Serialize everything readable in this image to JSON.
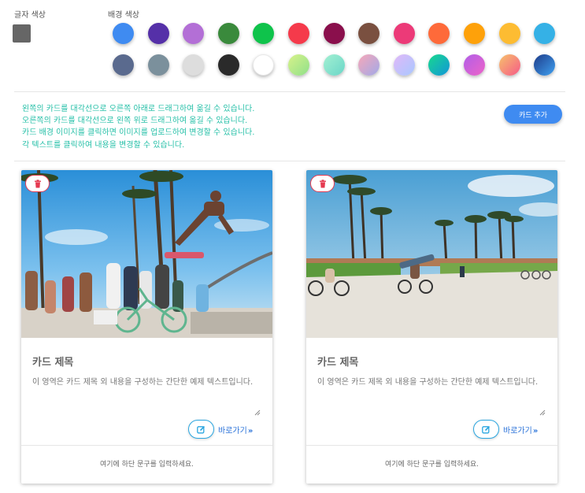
{
  "labels": {
    "text_color": "글자 색상",
    "bg_color": "배경 색상"
  },
  "text_color_value": "#666666",
  "palette": {
    "row1": [
      "#3f8bf1",
      "#5530a8",
      "#b36fd6",
      "#3a8a3c",
      "#0fc34b",
      "#f53a4b",
      "#8a0f4c",
      "#7a5040",
      "#ec3a78",
      "#fe6a3a",
      "#fea10a",
      "#fdbc32",
      "#35b1e6"
    ],
    "row2": [
      "#5a6a8e",
      "#7b909c",
      "#dddddd",
      "#2a2a2a",
      "#ffffff",
      "linear-gradient(135deg,#d8f28a,#8fe08a)",
      "linear-gradient(135deg,#a3f0d2,#6ad6c8)",
      "linear-gradient(135deg,#f7a8b8,#a1a9e8)",
      "linear-gradient(135deg,#e0b8f8,#a8c8ff)",
      "linear-gradient(135deg,#18d98d,#1296d9)",
      "linear-gradient(135deg,#b05ee8,#ee64c8)",
      "linear-gradient(135deg,#f7c26b,#f55a88)",
      "linear-gradient(135deg,#1e3c8a,#3fa0f0)"
    ]
  },
  "instructions": [
    "왼쪽의 카드를 대각선으로 오른쪽 아래로 드래그하여 옮길 수 있습니다.",
    "오른쪽의 카드를 대각선으로 왼쪽 위로 드래그하여 옮길 수 있습니다.",
    "카드 배경 이미지를 클릭하면 이미지를 업로드하여 변경할 수 있습니다.",
    "각 텍스트를 클릭하여 내용을 변경할 수 있습니다."
  ],
  "add_card_label": "카드 추가",
  "cards": [
    {
      "title": "카드 제목",
      "text": "이 영역은 카드 제목 외 내용을 구성하는 간단한 예제 텍스트입니다.",
      "link": "바로가기",
      "footer": "여기에 하단 문구를 입력하세요."
    },
    {
      "title": "카드 제목",
      "text": "이 영역은 카드 제목 외 내용을 구성하는 간단한 예제 텍스트입니다.",
      "link": "바로가기",
      "footer": "여기에 하단 문구를 입력하세요."
    }
  ],
  "icons": {
    "delete": "trash-icon",
    "edit": "edit-icon",
    "go": "double-chevron-right-icon"
  }
}
